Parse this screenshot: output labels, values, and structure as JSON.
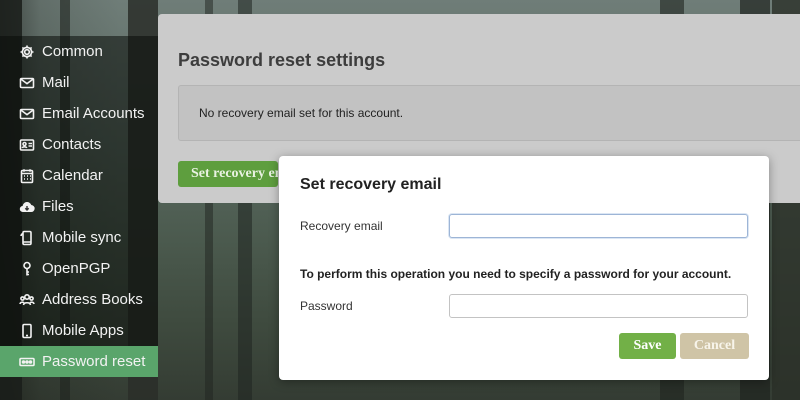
{
  "sidebar": {
    "items": [
      {
        "label": "Common",
        "icon": "gear-icon"
      },
      {
        "label": "Mail",
        "icon": "envelope-icon"
      },
      {
        "label": "Email Accounts",
        "icon": "envelope-icon"
      },
      {
        "label": "Contacts",
        "icon": "contact-card-icon"
      },
      {
        "label": "Calendar",
        "icon": "calendar-icon"
      },
      {
        "label": "Files",
        "icon": "cloud-download-icon"
      },
      {
        "label": "Mobile sync",
        "icon": "mobile-sync-icon"
      },
      {
        "label": "OpenPGP",
        "icon": "key-icon"
      },
      {
        "label": "Address Books",
        "icon": "address-book-icon"
      },
      {
        "label": "Mobile Apps",
        "icon": "mobile-phone-icon"
      },
      {
        "label": "Password reset",
        "icon": "password-dots-icon",
        "active": true
      }
    ]
  },
  "main": {
    "title": "Password reset settings",
    "info_text": "No recovery email set for this account.",
    "set_email_button": "Set recovery email"
  },
  "modal": {
    "title": "Set recovery email",
    "recovery_label": "Recovery email",
    "recovery_value": "",
    "note": "To perform this operation you need to specify a password for your account.",
    "password_label": "Password",
    "password_value": "",
    "save_label": "Save",
    "cancel_label": "Cancel"
  },
  "colors": {
    "active_nav": "#5aa56b",
    "save_button": "#72b047",
    "cancel_button": "#cfc4a6",
    "primary_button": "#5e9e3e"
  }
}
